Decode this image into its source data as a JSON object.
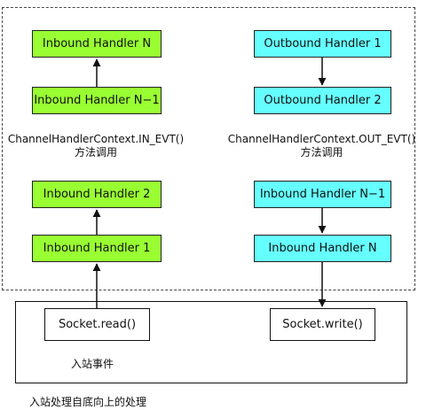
{
  "inbound": {
    "handler_n": "Inbound Handler N",
    "handler_n_minus_1": "Inbound Handler N−1",
    "caption_line1": "ChannelHandlerContext.IN_EVT()",
    "caption_line2": "方法调用",
    "handler_2": "Inbound Handler 2",
    "handler_1": "Inbound Handler 1"
  },
  "outbound": {
    "handler_1": "Outbound Handler 1",
    "handler_2": "Outbound Handler 2",
    "caption_line1": "ChannelHandlerContext.OUT_EVT()",
    "caption_line2": "方法调用",
    "handler_n_minus_1": "Inbound Handler N−1",
    "handler_n": "Inbound Handler N"
  },
  "socket": {
    "read": "Socket.read()",
    "write": "Socket.write()",
    "inbound_event_label": "入站事件"
  },
  "footer_label": "入站处理自底向上的处理",
  "colors": {
    "inbound_fill": "#99ff33",
    "outbound_fill": "#66ffff",
    "stroke": "#222222"
  }
}
